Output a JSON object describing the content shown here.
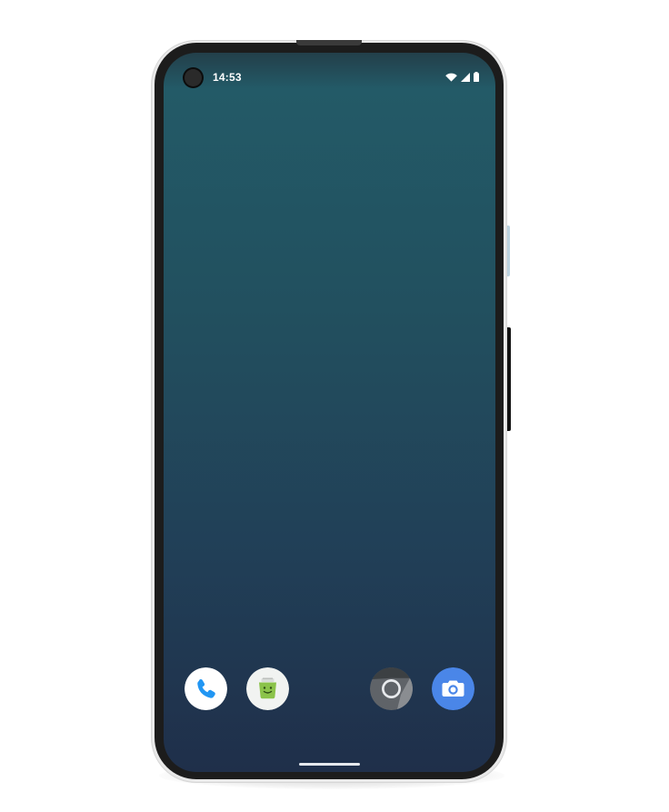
{
  "status_bar": {
    "time": "14:53",
    "icons": [
      "wifi-icon",
      "cellular-signal-icon",
      "battery-icon"
    ]
  },
  "dock": {
    "apps": [
      {
        "icon": "phone-icon",
        "accent": "#2196f3"
      },
      {
        "icon": "messaging-icon",
        "accent": "#8bc34a"
      },
      {
        "icon": "chrome-icon",
        "accent": "#9e9e9e"
      },
      {
        "icon": "camera-icon",
        "accent": "#4a86e8"
      }
    ]
  },
  "colors": {
    "wallpaper_top": "#235a67",
    "wallpaper_bottom": "#1f2f4a",
    "bezel": "#1c1c1c"
  }
}
